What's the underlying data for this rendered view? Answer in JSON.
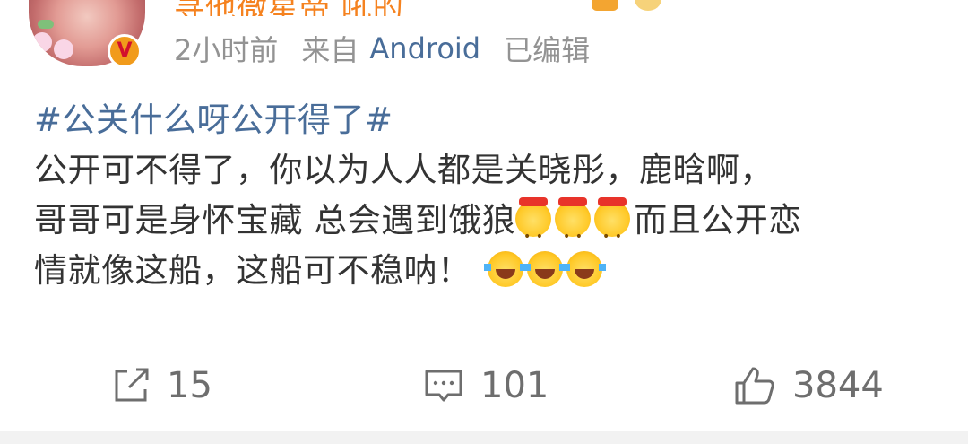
{
  "post": {
    "author": {
      "name": "寻他微星帝 吼的",
      "verified_badge": "V",
      "accent_color": "#f5821f"
    },
    "meta": {
      "time": "2小时前",
      "source_prefix": "来自",
      "source_app": "Android",
      "edited": "已编辑"
    },
    "hashtag": "#公关什么呀公开得了#",
    "body": {
      "line1": "公开可不得了，你以为人人都是关晓彤，鹿晗啊，",
      "line2_text": "哥哥可是身怀宝藏 总会遇到饿狼",
      "line2_tail": "而且公开恋",
      "line3_text": "情就像这船，这船可不稳呐！",
      "emoji_line2": [
        "emoji-hat",
        "emoji-hat",
        "emoji-hat"
      ],
      "emoji_line3": [
        "emoji-laugh-cry",
        "emoji-laugh-cry",
        "emoji-laugh-cry"
      ]
    },
    "actions": {
      "repost_count": "15",
      "comment_count": "101",
      "like_count": "3844",
      "icons": [
        "repost-icon",
        "comment-icon",
        "like-icon"
      ]
    },
    "colors": {
      "link": "#496d99",
      "text": "#333333",
      "meta": "#939393",
      "action": "#6e6e6e"
    }
  }
}
